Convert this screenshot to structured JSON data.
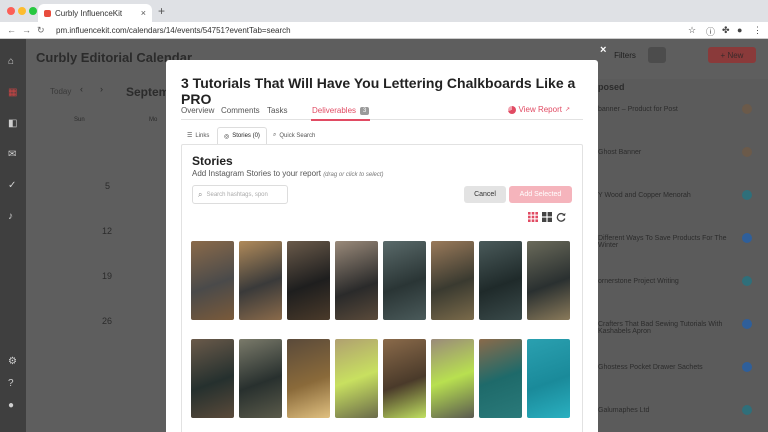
{
  "browser": {
    "tab_title": "Curbly InfluenceKit",
    "tab_close": "×",
    "new_tab": "+",
    "url": "pm.influencekit.com/calendars/14/events/54751?eventTab=search",
    "traffic_colors": [
      "#fc5f57",
      "#fdbc2e",
      "#28c840"
    ]
  },
  "background_app": {
    "title": "Curbly Editorial Calendar",
    "today": "Today",
    "month": "Septemb",
    "prev": "‹",
    "next": "›",
    "day_headers": [
      "Sun",
      "Mo"
    ],
    "days": [
      "5",
      "12",
      "19",
      "26"
    ],
    "filters_label": "Filters",
    "new_label": "+ New",
    "panel_title": "posed",
    "panel_items": [
      "banner – Product for Post",
      "Ghost Banner",
      "Y Wood and Copper Menorah",
      "Different Ways To Save Products For The Winter",
      "ornerstone Project Writing",
      "Crafters That Bad Sewing Tutorials With Kashabels Apron",
      "Ghostess Pocket Drawer Sachets",
      "Galumaphes Ltd"
    ]
  },
  "modal": {
    "close": "×",
    "title": "3 Tutorials That Will Have You Lettering Chalkboards Like a PRO",
    "tabs": [
      {
        "label": "Overview"
      },
      {
        "label": "Comments"
      },
      {
        "label": "Tasks"
      },
      {
        "label": "Deliverables",
        "badge": "3"
      }
    ],
    "view_report": "View Report",
    "sub_tabs": [
      {
        "label": "Links",
        "icon": "link-icon"
      },
      {
        "label": "Stories (0)",
        "icon": "instagram-icon"
      },
      {
        "label": "Quick Search",
        "icon": "search-icon"
      }
    ],
    "panel": {
      "title": "Stories",
      "subtitle": "Add Instagram Stories to your report",
      "hint": "(drag or click to select)",
      "search_placeholder": "Search hashtags, spon",
      "cancel": "Cancel",
      "add_selected": "Add Selected"
    },
    "accent": "#e14b63"
  }
}
